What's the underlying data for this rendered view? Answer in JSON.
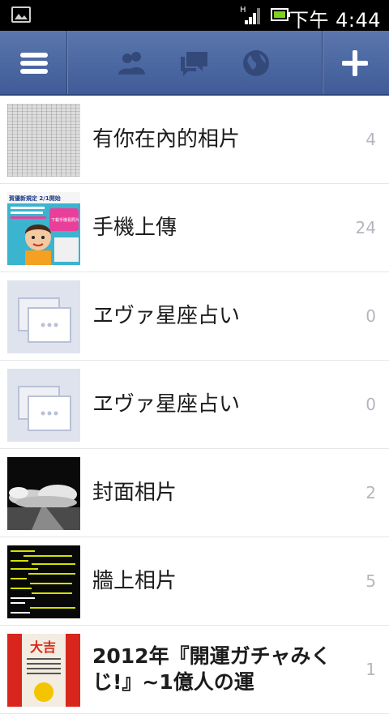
{
  "status_bar": {
    "time": "下午 4:44",
    "network_label": "H"
  },
  "top_bar": {
    "icons": [
      "menu-icon",
      "friends-icon",
      "messages-icon",
      "globe-icon",
      "add-icon"
    ],
    "brand_color": "#4a66a0"
  },
  "albums": [
    {
      "title": "有你在內的相片",
      "count": "4",
      "thumb": "tagged-photos"
    },
    {
      "title": "手機上傳",
      "count": "24",
      "thumb": "mobile-uploads"
    },
    {
      "title": "ヱヴァ星座占い",
      "count": "0",
      "thumb": "placeholder"
    },
    {
      "title": "ヱヴァ星座占い",
      "count": "0",
      "thumb": "placeholder"
    },
    {
      "title": "封面相片",
      "count": "2",
      "thumb": "cover-photo"
    },
    {
      "title": "牆上相片",
      "count": "5",
      "thumb": "wall-photo"
    },
    {
      "title": "2012年『開運ガチャみくじ!』~1億人の運",
      "count": "1",
      "thumb": "gacha"
    }
  ],
  "mobile_thumb_text": {
    "headline": "賀優新規定 2/1開始",
    "badge": "下載手機看照片"
  },
  "gacha_thumb_text": "大吉"
}
